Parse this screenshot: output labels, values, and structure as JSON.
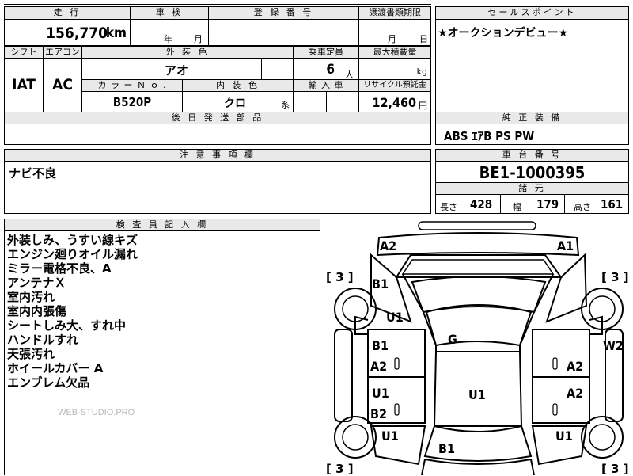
{
  "top_row": {
    "mileage_header": "走 行",
    "inspection_header": "車 検",
    "registration_header": "登 録 番 号",
    "transfer_header": "譲渡書類期限",
    "mileage_value": "156,770",
    "mileage_unit": "km",
    "inspection_year_unit": "年",
    "inspection_month_unit": "月",
    "transfer_month_unit": "月",
    "transfer_day_unit": "日"
  },
  "spec": {
    "shift_header": "シフト",
    "ac_header": "エアコン",
    "exterior_color_header": "外 装 色",
    "capacity_header": "乗車定員",
    "max_load_header": "最大積載量",
    "shift_value": "IAT",
    "ac_value": "AC",
    "exterior_color_value": "アオ",
    "capacity_value": "6",
    "capacity_unit": "人",
    "load_unit": "kg",
    "color_no_header": "カ ラ ー Ｎ ｏ .",
    "interior_color_header": "内 装 色",
    "import_header": "輸 入 車",
    "recycle_header": "リサイクル預託金",
    "color_no_value": "B520P",
    "interior_color_value": "クロ",
    "interior_color_suffix": "系",
    "recycle_value": "12,460",
    "recycle_unit": "円",
    "later_parts_header": "後 日 発 送 部 品"
  },
  "sales_point": {
    "header": "セールスポイント",
    "text": "★オークションデビュー★"
  },
  "equipment": {
    "header": "純 正 装 備",
    "text": "ABS ｴｱB PS PW"
  },
  "caution": {
    "header": "注 意 事 項 欄",
    "text": "ナビ不良"
  },
  "chassis": {
    "header": "車 台 番 号",
    "value": "BE1-1000395",
    "dimensions_header": "諸 元",
    "length_label": "長さ",
    "length_value": "428",
    "width_label": "幅",
    "width_value": "179",
    "height_label": "高さ",
    "height_value": "161"
  },
  "inspector": {
    "header": "検 査 員 記 入 欄",
    "notes": [
      "外装しみ、うすい線キズ",
      "エンジン廻りオイル漏れ",
      "ミラー電格不良、A",
      "アンテナＸ",
      "室内汚れ",
      "室内内張傷",
      "シートしみ大、すれ中",
      "ハンドルすれ",
      "天張汚れ",
      "ホイールカバー A",
      "エンブレム欠品"
    ],
    "watermark": "WEB-STUDIO.PRO"
  },
  "diagram": {
    "marks": {
      "front_left": "A2",
      "front_right": "A1",
      "tire_fl": "[ 3 ]",
      "tire_fr": "[ 3 ]",
      "tire_rl": "[ 3 ]",
      "tire_rr": "[ 3 ]",
      "fender_left": "B1",
      "fender_left_2": "U1",
      "windshield": "G",
      "door_fl_1": "B1",
      "door_fl_2": "A2",
      "door_fr": "A2",
      "side_right": "W2",
      "door_rl_1": "U1",
      "door_rl_2": "B2",
      "door_rr": "A2",
      "roof": "U1",
      "quarter_left": "U1",
      "quarter_right": "U1",
      "rear": "B1"
    }
  }
}
